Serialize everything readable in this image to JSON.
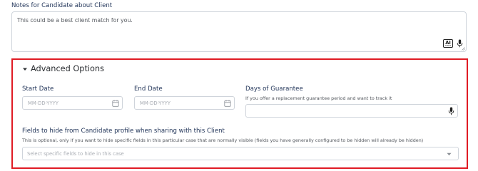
{
  "notes": {
    "label": "Notes for Candidate about Client",
    "value": "This could be a best client match for you.",
    "ai_badge_main": "AI",
    "ai_badge_sub": "ASSIST"
  },
  "advanced": {
    "title": "Advanced Options",
    "start_date": {
      "label": "Start Date",
      "placeholder": "MM-DD-YYYY"
    },
    "end_date": {
      "label": "End Date",
      "placeholder": "MM-DD-YYYY"
    },
    "guarantee": {
      "label": "Days of Guarantee",
      "helper": "If you offer a replacement guarantee period and want to track it"
    },
    "hide_fields": {
      "label": "Fields to hide from Candidate profile when sharing with this Client",
      "helper": "This is optional, only if you want to hide specific fields in this particular case that are normally visible (fields you have generally configured to be hidden will already be hidden)",
      "placeholder": "Select specific fields to hide in this case"
    }
  },
  "colors": {
    "label": "#23365a",
    "highlight_border": "#e01b24",
    "input_border": "#cfd4db",
    "placeholder": "#a9adb4"
  },
  "icons": [
    "ai-assist-icon",
    "microphone-icon",
    "resize-grip-icon",
    "caret-down-icon",
    "calendar-icon",
    "chevron-down-icon"
  ]
}
